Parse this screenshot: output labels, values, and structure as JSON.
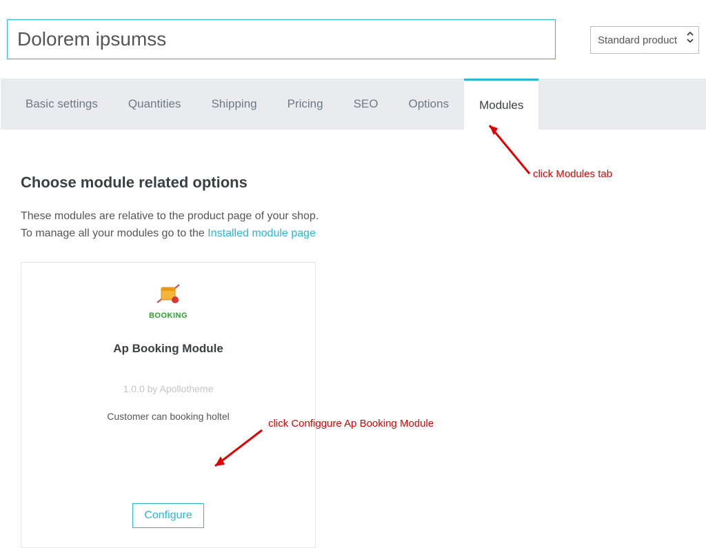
{
  "header": {
    "product_name": "Dolorem ipsumss",
    "product_type_selected": "Standard product"
  },
  "tabs": [
    {
      "id": "basic",
      "label": "Basic settings",
      "active": false
    },
    {
      "id": "qty",
      "label": "Quantities",
      "active": false
    },
    {
      "id": "ship",
      "label": "Shipping",
      "active": false
    },
    {
      "id": "price",
      "label": "Pricing",
      "active": false
    },
    {
      "id": "seo",
      "label": "SEO",
      "active": false
    },
    {
      "id": "opt",
      "label": "Options",
      "active": false
    },
    {
      "id": "mod",
      "label": "Modules",
      "active": true
    }
  ],
  "modules_panel": {
    "title": "Choose module related options",
    "desc_line1": "These modules are relative to the product page of your shop.",
    "desc_line2_prefix": "To manage all your modules go to the ",
    "desc_line2_link": "Installed module page"
  },
  "module_card": {
    "icon_caption": "BOOKING",
    "name": "Ap Booking Module",
    "version_line": "1.0.0 by Apollotheme",
    "description": "Customer can booking holtel",
    "configure_label": "Configure"
  },
  "annotations": {
    "modules_tab_note": "click Modules tab",
    "configure_note": "click Configgure Ap Booking Module"
  }
}
